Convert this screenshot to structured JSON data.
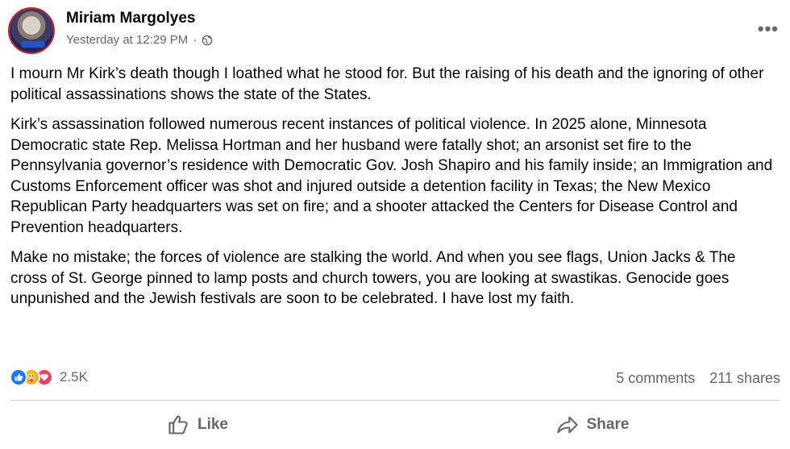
{
  "post": {
    "author": "Miriam Margolyes",
    "timestamp": "Yesterday at 12:29 PM",
    "separator": "·",
    "privacy_icon": "globe-icon",
    "more_label": "•••",
    "paragraphs": [
      "I mourn Mr Kirk’s death though I loathed what he stood for. But the raising of his death and the ignoring of other political assassinations shows the state of the States.",
      "Kirk’s assassination followed numerous recent instances of political violence. In 2025 alone, Minnesota Democratic state Rep. Melissa Hortman and her husband were fatally shot; an arsonist set fire to the Pennsylvania governor’s residence with Democratic Gov. Josh Shapiro and his family inside; an Immigration and Customs Enforcement officer was shot and injured outside a detention facility in Texas; the New Mexico Republican Party headquarters was set on fire; and a shooter attacked the Centers for Disease Control and Prevention headquarters.",
      "Make no mistake; the forces of violence are stalking the world. And when you see flags, Union Jacks & The cross of St. George pinned to lamp posts and church towers, you are looking at swastikas. Genocide goes unpunished and the Jewish festivals are soon to be celebrated. I have lost my faith."
    ]
  },
  "engagement": {
    "reaction_icons": [
      "like-icon",
      "care-icon",
      "love-icon"
    ],
    "reaction_count": "2.5K",
    "comments": "5 comments",
    "shares": "211 shares"
  },
  "actions": {
    "like_label": "Like",
    "share_label": "Share"
  },
  "colors": {
    "like_blue": "#1877f2",
    "care_yellow": "#f7b125",
    "love_red": "#f33e58",
    "secondary_text": "#65676b"
  }
}
